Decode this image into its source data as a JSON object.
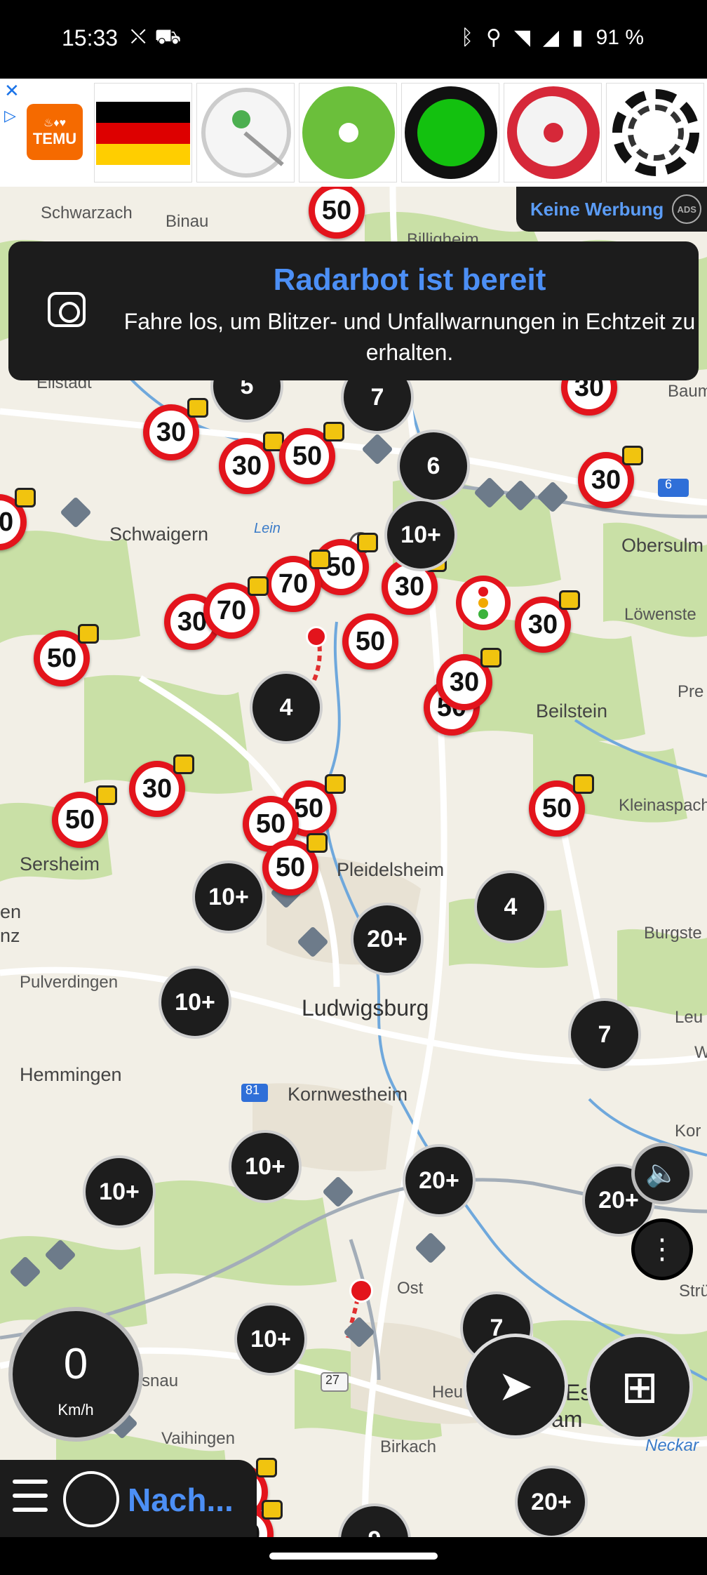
{
  "status_bar": {
    "time": "15:33",
    "left_icons": [
      "no-signal-icon",
      "car-sync-icon"
    ],
    "right_icons": [
      "bluetooth-icon",
      "location-icon",
      "wifi-icon",
      "signal-icon",
      "battery-icon"
    ],
    "battery": "91 %"
  },
  "ad_banner": {
    "brand": "TEMU",
    "product_icons": [
      "german-flag-icon",
      "magnifier-product-icon",
      "green-disc-icon",
      "green-button-icon",
      "red-button-icon",
      "spring-coil-icon"
    ]
  },
  "no_ads": {
    "label": "Keine Werbung",
    "badge": "ADS"
  },
  "toast": {
    "title": "Radarbot ist bereit",
    "message": "Fahre los, um Blitzer- und Unfallwarnungen in Echtzeit zu erhalten."
  },
  "map": {
    "places": [
      {
        "name": "Schwarzach"
      },
      {
        "name": "Binau"
      },
      {
        "name": "Billigheim"
      },
      {
        "name": "Eilstadt"
      },
      {
        "name": "Baum"
      },
      {
        "name": "Schwaigern"
      },
      {
        "name": "Obersulm"
      },
      {
        "name": "Löwenste"
      },
      {
        "name": "Pre"
      },
      {
        "name": "Beilstein"
      },
      {
        "name": "Kleinaspach"
      },
      {
        "name": "Sersheim"
      },
      {
        "name": "Pleidelsheim"
      },
      {
        "name": "en"
      },
      {
        "name": "nz"
      },
      {
        "name": "Burgste"
      },
      {
        "name": "Pulverdingen"
      },
      {
        "name": "Ludwigsburg"
      },
      {
        "name": "Leu"
      },
      {
        "name": "W"
      },
      {
        "name": "Hemmingen"
      },
      {
        "name": "Kornwestheim"
      },
      {
        "name": "Kor"
      },
      {
        "name": "Ost"
      },
      {
        "name": "Strü"
      },
      {
        "name": "snau"
      },
      {
        "name": "Heu"
      },
      {
        "name": "Es"
      },
      {
        "name": "am"
      },
      {
        "name": "Vaihingen"
      },
      {
        "name": "Birkach"
      },
      {
        "name": "Neckar"
      },
      {
        "name": "Lein"
      }
    ],
    "road_labels": [
      "6",
      "81",
      "27"
    ],
    "speed_signs": [
      "50",
      "30",
      "30",
      "50",
      "30",
      "50",
      "30",
      "70",
      "50",
      "30",
      "70",
      "50",
      "30",
      "50",
      "30",
      "30",
      "50",
      "30",
      "50",
      "50",
      "50",
      "50",
      "30",
      "50",
      "30",
      "50",
      "50",
      "50"
    ],
    "clusters": [
      "5",
      "7",
      "6",
      "10+",
      "4",
      "10+",
      "4",
      "20+",
      "10+",
      "7",
      "10+",
      "20+",
      "10+",
      "20+",
      "10+",
      "7",
      "20+",
      "9"
    ]
  },
  "controls": {
    "speed_value": "0",
    "speed_unit": "Km/h",
    "nav_label": "Nach..."
  }
}
